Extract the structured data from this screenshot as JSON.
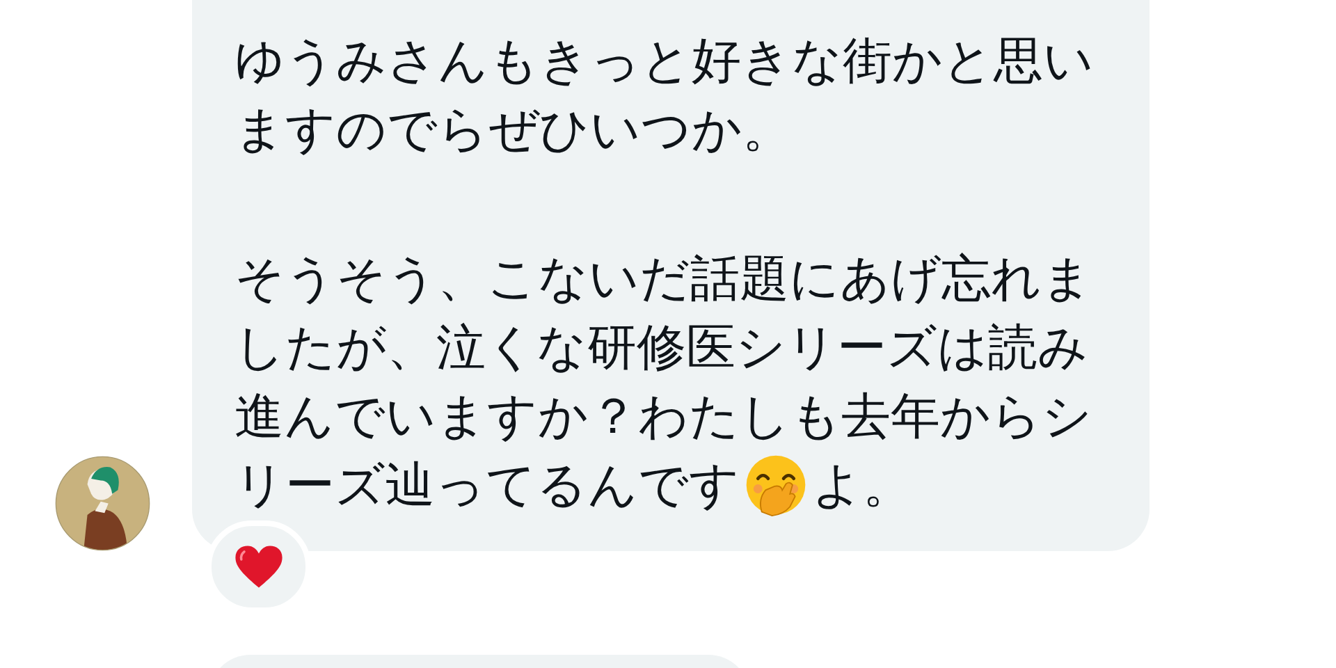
{
  "message": {
    "paragraphs": [
      {
        "lines": [
          "ゆうみさんもきっと好きな街かと思い",
          "ますのでらぜひいつか。"
        ]
      },
      {
        "lines": [
          "そうそう、こないだ話題にあげ忘れま",
          "したが、泣くな研修医シリーズは読み",
          "進んでいますか？わたしも去年からシ"
        ],
        "last_line": {
          "kind": "emoji_between",
          "before": "リーズ辿ってるんです",
          "after": "よ。"
        }
      }
    ],
    "reactions": [
      {
        "kind": "heart"
      }
    ]
  }
}
